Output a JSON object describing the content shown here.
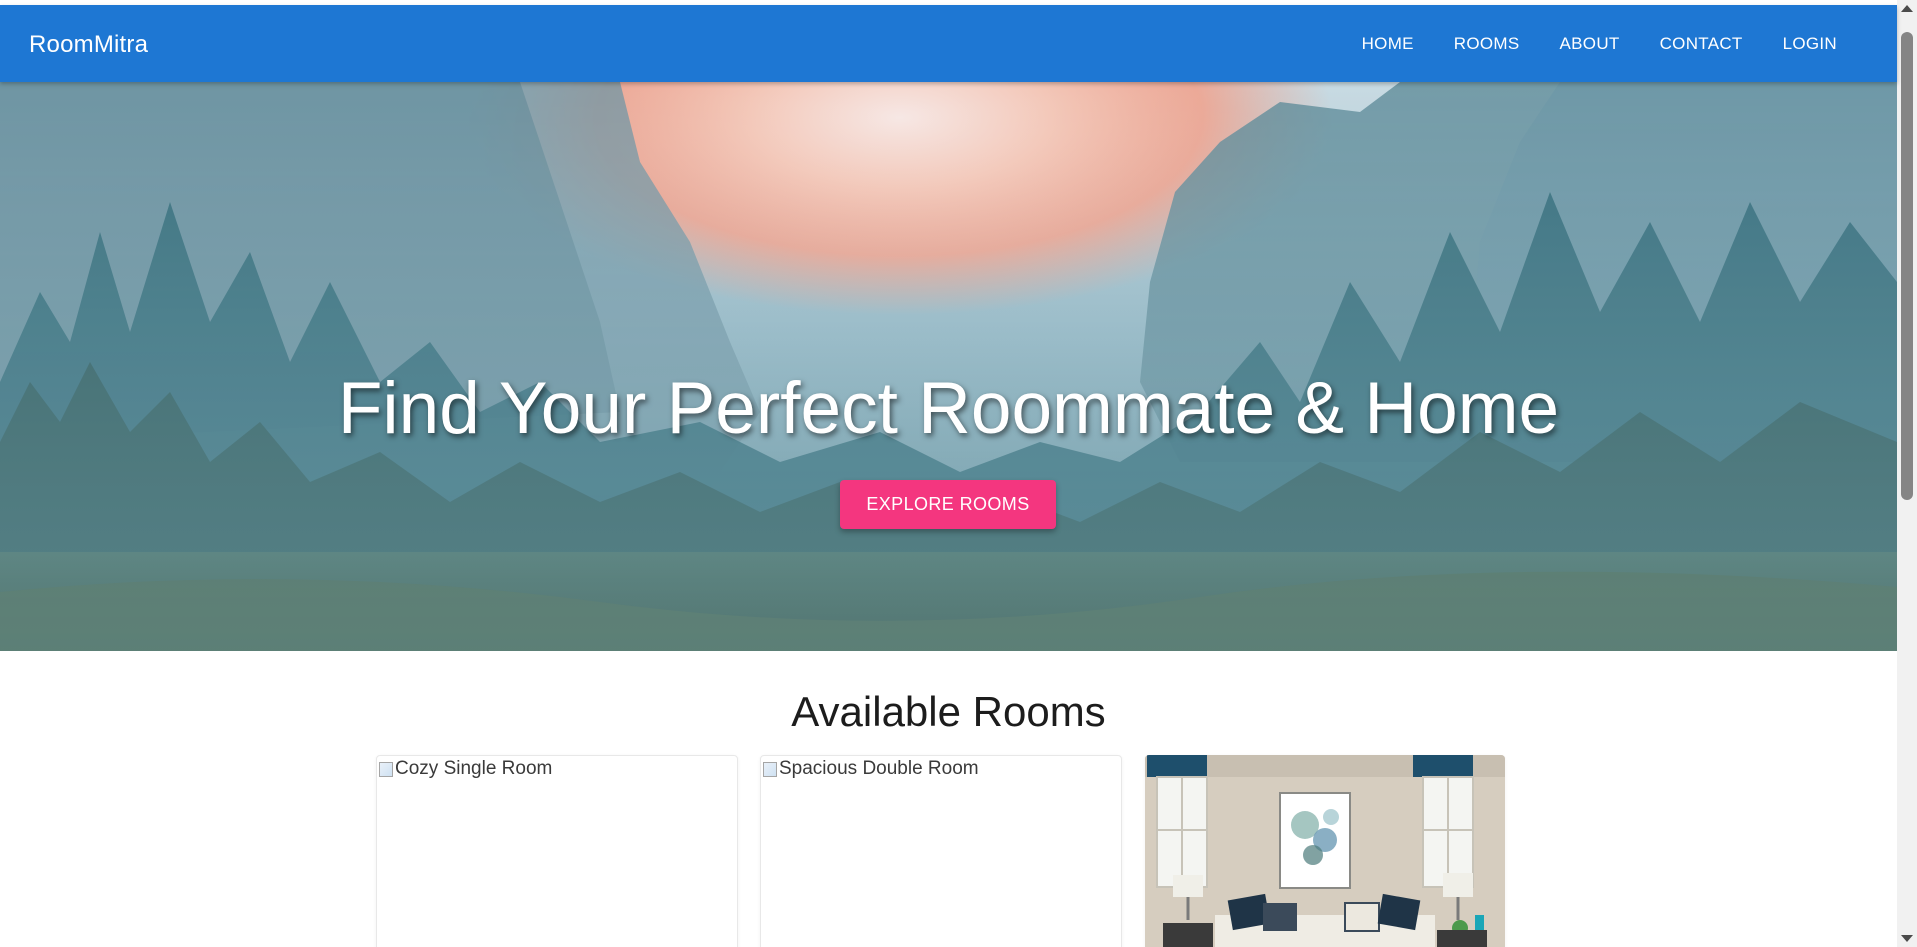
{
  "navbar": {
    "brand": "RoomMitra",
    "links": [
      "HOME",
      "ROOMS",
      "ABOUT",
      "CONTACT",
      "LOGIN"
    ],
    "color": "#1e77d3"
  },
  "hero": {
    "title": "Find Your Perfect Roommate & Home",
    "button_label": "EXPLORE ROOMS",
    "button_color": "#f4367f"
  },
  "rooms": {
    "heading": "Available Rooms",
    "cards": [
      {
        "image_alt": "Cozy Single Room"
      },
      {
        "image_alt": "Spacious Double Room"
      },
      {
        "image_alt": ""
      }
    ]
  }
}
